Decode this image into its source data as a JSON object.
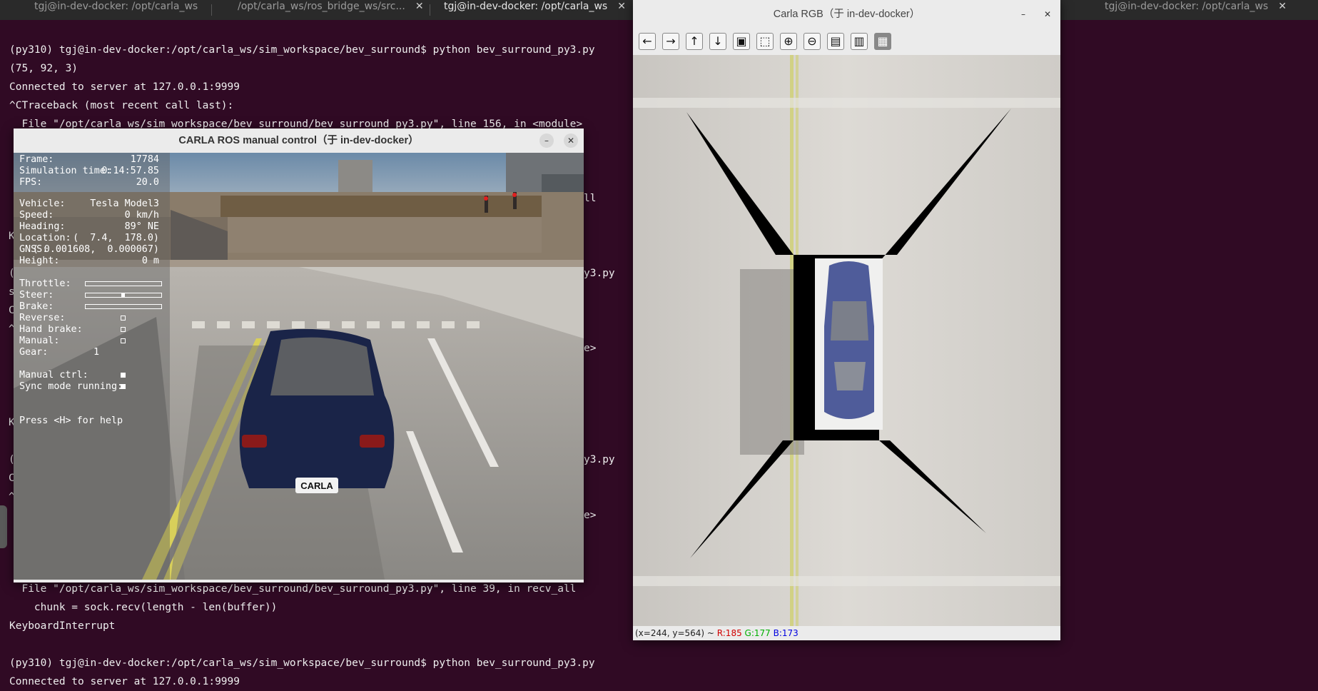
{
  "terminal_tabs": [
    {
      "label": "tgj@in-dev-docker: /opt/carla_ws",
      "close": "✕",
      "active": false
    },
    {
      "label": "/opt/carla_ws/ros_bridge_ws/src...",
      "close": "✕",
      "active": false
    },
    {
      "label": "tgj@in-dev-docker: /opt/carla_ws",
      "close": "✕",
      "active": true
    },
    {
      "label": "tgj@in-dev-docker: /opt/carla_ws",
      "close": "✕",
      "active": false
    }
  ],
  "terminal": {
    "lines": [
      "(py310) tgj@in-dev-docker:/opt/carla_ws/sim_workspace/bev_surround$ python bev_surround_py3.py",
      "(75, 92, 3)",
      "Connected to server at 127.0.0.1:9999",
      "^CTraceback (most recent call last):",
      "  File \"/opt/carla_ws/sim_workspace/bev_surround/bev_surround_py3.py\", line 156, in <module>",
      "  File \"/opt/carla_ws/sim_workspace/bev_surround/bev_surround_py3.py\", line 39, in recv_all",
      "    chunk = sock.recv(length - len(buffer))",
      "KeyboardInterrupt",
      "(py310) tgj@in-dev-docker:/opt/carla_ws/sim_workspace/bev_surround$ python bev_surround_py3.py",
      "Connected to server at 127.0.0.1:9999"
    ],
    "fragments": [
      "ll",
      "y3.py",
      "e>",
      "y3.py",
      "e>",
      "K",
      "(",
      "s",
      "C",
      "^",
      "K",
      "(",
      "C",
      "^"
    ]
  },
  "manual_control": {
    "title": "CARLA ROS manual control（于 in-dev-docker）",
    "minimize": "–",
    "close": "✕",
    "hud": {
      "frame_label": "Frame:",
      "frame_value": "17784",
      "sim_time_label": "Simulation time:",
      "sim_time_value": "0:14:57.85",
      "fps_label": "FPS:",
      "fps_value": "20.0",
      "vehicle_label": "Vehicle:",
      "vehicle_value": "Tesla Model3",
      "speed_label": "Speed:",
      "speed_value": "0 km/h",
      "heading_label": "Heading:",
      "heading_value": "89° NE",
      "location_label": "Location:",
      "location_value": "(  7.4,  178.0)",
      "gnss_label": "GNSS:",
      "gnss_value": "( 0.001608,  0.000067)",
      "height_label": "Height:",
      "height_value": "0 m",
      "throttle_label": "Throttle:",
      "throttle": 0.0,
      "steer_label": "Steer:",
      "steer": 0.0,
      "brake_label": "Brake:",
      "brake": 0.0,
      "reverse_label": "Reverse:",
      "reverse": false,
      "hand_brake_label": "Hand brake:",
      "hand_brake": false,
      "manual_label": "Manual:",
      "manual": false,
      "gear_label": "Gear:",
      "gear_value": "1",
      "manual_ctrl_label": "Manual ctrl:",
      "manual_ctrl": true,
      "sync_label": "Sync mode running:",
      "sync": true,
      "help_text": "Press <H> for help"
    },
    "plate_text": "CARLA"
  },
  "rgb_window": {
    "title": "Carla RGB（于 in-dev-docker）",
    "minimize": "–",
    "close": "✕",
    "toolbar": [
      {
        "name": "arrow-left-icon",
        "glyph": "←"
      },
      {
        "name": "arrow-right-icon",
        "glyph": "→"
      },
      {
        "name": "arrow-up-icon",
        "glyph": "↑"
      },
      {
        "name": "arrow-down-icon",
        "glyph": "↓"
      },
      {
        "name": "zoom-fit-icon",
        "glyph": "▣"
      },
      {
        "name": "zoom-rect-icon",
        "glyph": "⬚"
      },
      {
        "name": "zoom-in-icon",
        "glyph": "⊕"
      },
      {
        "name": "zoom-out-icon",
        "glyph": "⊖"
      },
      {
        "name": "save-icon",
        "glyph": "▤"
      },
      {
        "name": "copy-icon",
        "glyph": "▥"
      },
      {
        "name": "properties-icon",
        "glyph": "▦"
      }
    ],
    "status": {
      "coords": "(x=244, y=564) ~ ",
      "r": "R:185",
      "g": "G:177",
      "b": "B:173",
      "r_color": "#d00000",
      "g_color": "#00b000",
      "b_color": "#0000e0"
    }
  },
  "colors": {
    "terminal_bg": "#300a24",
    "tabbar_bg": "#2a2a2a",
    "window_chrome": "#ebebeb"
  }
}
